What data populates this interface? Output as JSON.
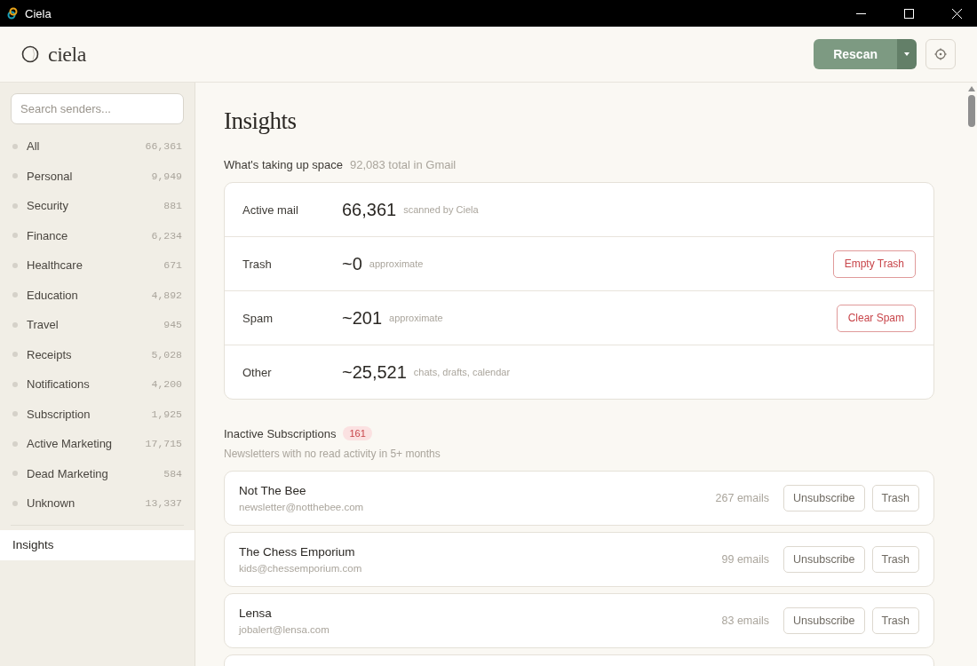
{
  "window": {
    "title": "Ciela"
  },
  "header": {
    "logo_text": "ciela",
    "rescan_button": "Rescan"
  },
  "sidebar": {
    "search": {
      "placeholder": "Search senders..."
    },
    "categories": [
      {
        "label": "All",
        "count": "66,361",
        "selected": false
      },
      {
        "label": "Personal",
        "count": "9,949",
        "selected": false
      },
      {
        "label": "Security",
        "count": "881",
        "selected": false
      },
      {
        "label": "Finance",
        "count": "6,234",
        "selected": false
      },
      {
        "label": "Healthcare",
        "count": "671",
        "selected": false
      },
      {
        "label": "Education",
        "count": "4,892",
        "selected": false
      },
      {
        "label": "Travel",
        "count": "945",
        "selected": false
      },
      {
        "label": "Receipts",
        "count": "5,028",
        "selected": false
      },
      {
        "label": "Notifications",
        "count": "4,200",
        "selected": false
      },
      {
        "label": "Subscription",
        "count": "1,925",
        "selected": false
      },
      {
        "label": "Active Marketing",
        "count": "17,715",
        "selected": false
      },
      {
        "label": "Dead Marketing",
        "count": "584",
        "selected": false
      },
      {
        "label": "Unknown",
        "count": "13,337",
        "selected": false
      }
    ],
    "insights": {
      "label": "Insights",
      "selected": true
    }
  },
  "main": {
    "title": "Insights",
    "space": {
      "heading": "What's taking up space",
      "total": "92,083 total in Gmail",
      "rows": [
        {
          "label": "Active mail",
          "value": "66,361",
          "note": "scanned by Ciela"
        },
        {
          "label": "Trash",
          "value": "~0",
          "note": "approximate",
          "action": "Empty Trash"
        },
        {
          "label": "Spam",
          "value": "~201",
          "note": "approximate",
          "action": "Clear Spam"
        },
        {
          "label": "Other",
          "value": "~25,521",
          "note": "chats, drafts, calendar"
        }
      ]
    },
    "inactive": {
      "heading": "Inactive Subscriptions",
      "badge": "161",
      "subtitle": "Newsletters with no read activity in 5+ months",
      "senders": [
        {
          "name": "Not The Bee",
          "email": "newsletter@notthebee.com",
          "count": "267 emails",
          "unsubscribe": "Unsubscribe",
          "trash": "Trash"
        },
        {
          "name": "The Chess Emporium",
          "email": "kids@chessemporium.com",
          "count": "99 emails",
          "unsubscribe": "Unsubscribe",
          "trash": "Trash"
        },
        {
          "name": "Lensa",
          "email": "jobalert@lensa.com",
          "count": "83 emails",
          "unsubscribe": "Unsubscribe",
          "trash": "Trash"
        }
      ]
    }
  }
}
